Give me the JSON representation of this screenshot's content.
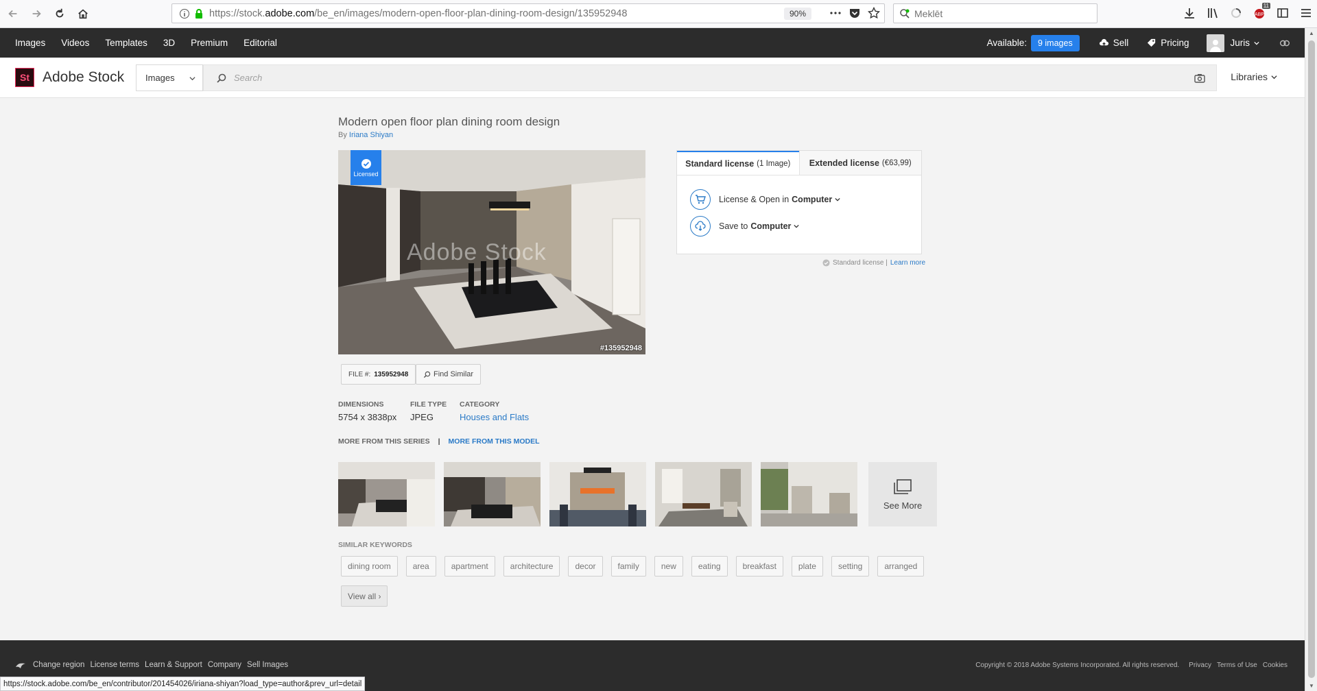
{
  "browser": {
    "url_prefix": "https://stock.",
    "url_domain": "adobe.com",
    "url_rest": "/be_en/images/modern-open-floor-plan-dining-room-design/135952948",
    "zoom": "90%",
    "search_placeholder": "Meklēt",
    "badge_count": "11",
    "status_url": "https://stock.adobe.com/be_en/contributor/201454026/iriana-shiyan?load_type=author&prev_url=detail"
  },
  "topnav": {
    "items": [
      "Images",
      "Videos",
      "Templates",
      "3D",
      "Premium",
      "Editorial"
    ],
    "available_label": "Available:",
    "available_count": "9 images",
    "sell": "Sell",
    "pricing": "Pricing",
    "user": "Juris"
  },
  "header": {
    "logo_mark": "St",
    "logo_text": "Adobe Stock",
    "select_value": "Images",
    "search_placeholder": "Search",
    "libraries": "Libraries"
  },
  "asset": {
    "title": "Modern open floor plan dining room design",
    "by_label": "By",
    "author": "Iriana Shiyan",
    "licensed_label": "Licensed",
    "watermark": "Adobe Stock",
    "image_id": "#135952948",
    "file_label": "FILE #:",
    "file_number": "135952948",
    "find_similar": "Find Similar",
    "dimensions_label": "DIMENSIONS",
    "dimensions": "5754 x 3838px",
    "filetype_label": "FILE TYPE",
    "filetype": "JPEG",
    "category_label": "CATEGORY",
    "category": "Houses and Flats",
    "more_series": "MORE FROM THIS SERIES",
    "separator": "|",
    "more_model": "MORE FROM THIS MODEL",
    "see_more": "See More",
    "keywords_title": "SIMILAR KEYWORDS",
    "keywords": [
      "dining room",
      "area",
      "apartment",
      "architecture",
      "decor",
      "family",
      "new",
      "eating",
      "breakfast",
      "plate",
      "setting",
      "arranged"
    ],
    "view_all": "View all ›"
  },
  "license": {
    "standard_tab": "Standard license",
    "standard_sub": "(1 Image)",
    "extended_tab": "Extended license",
    "extended_sub": "(€63,99)",
    "action1_pre": "License & Open in",
    "action1_target": "Computer",
    "action2_pre": "Save to",
    "action2_target": "Computer",
    "note": "Standard license |",
    "learn_more": "Learn more"
  },
  "footer": {
    "links": [
      "Change region",
      "License terms",
      "Learn & Support",
      "Company",
      "Sell Images"
    ],
    "copyright": "Copyright © 2018 Adobe Systems Incorporated. All rights reserved.",
    "privacy": "Privacy",
    "terms": "Terms of Use",
    "cookies": "Cookies"
  },
  "colors": {
    "accent": "#2680eb",
    "link": "#2a7ac7",
    "nav_bg": "#2c2c2c"
  }
}
